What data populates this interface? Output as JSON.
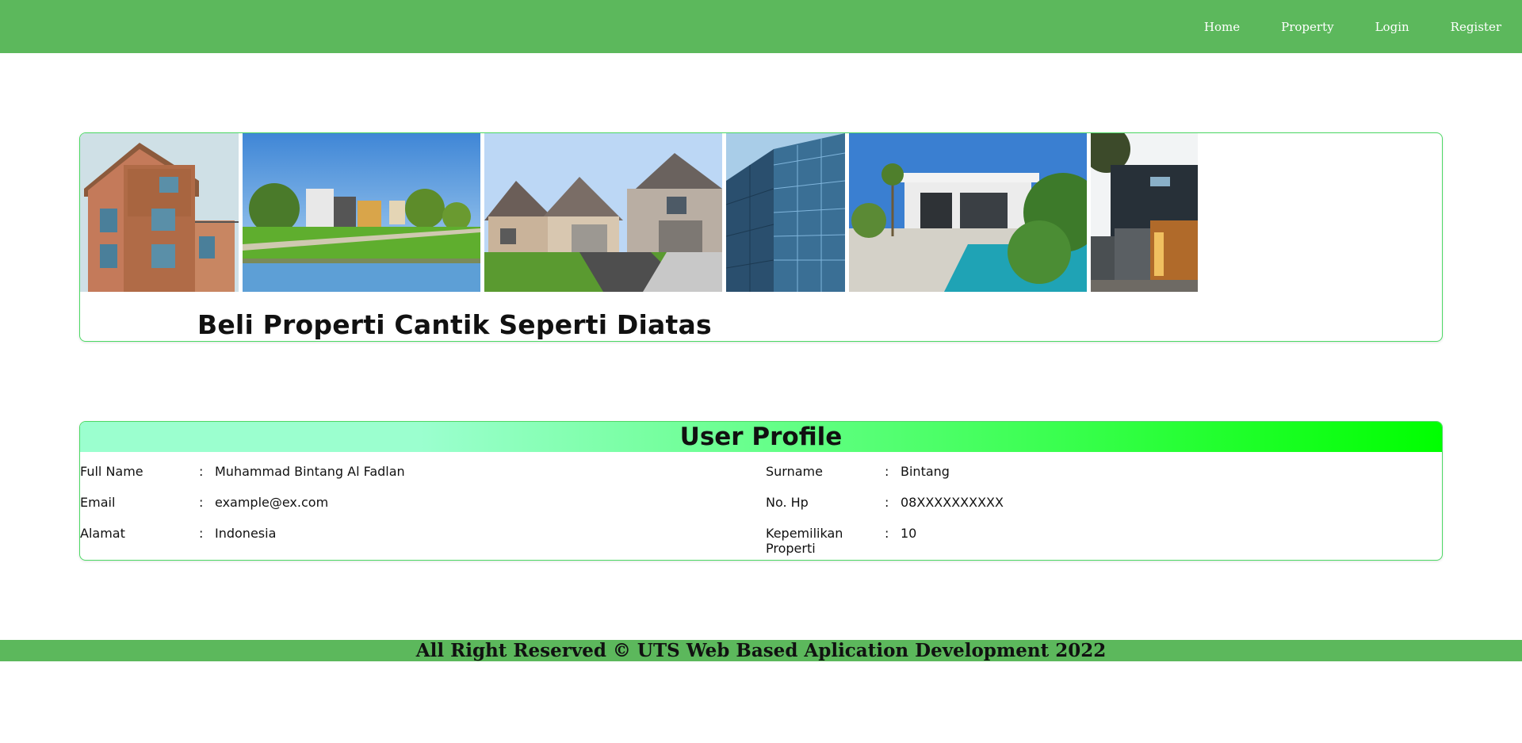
{
  "nav": {
    "links": [
      "Home",
      "Property",
      "Login",
      "Register"
    ]
  },
  "banner": {
    "title": "Beli Properti Cantik Seperti Diatas",
    "photos": [
      "wooden-townhouse-photo",
      "lakeside-houses-photo",
      "suburban-houses-photo",
      "glass-skyscraper-photo",
      "modern-villa-pool-photo",
      "dark-modern-house-photo"
    ]
  },
  "profile": {
    "title": "User Profile",
    "left": [
      {
        "label": "Full Name",
        "value": "Muhammad Bintang Al Fadlan"
      },
      {
        "label": "Email",
        "value": "example@ex.com"
      },
      {
        "label": "Alamat",
        "value": "Indonesia"
      }
    ],
    "right": [
      {
        "label": "Surname",
        "value": "Bintang"
      },
      {
        "label": "No. Hp",
        "value": "08XXXXXXXXXX"
      },
      {
        "label": "Kepemilikan Properti",
        "value": "10"
      }
    ],
    "separator": ":"
  },
  "footer": {
    "text": "All Right Reserved © UTS Web Based Aplication Development 2022"
  },
  "colors": {
    "nav_bg": "#5cb85c",
    "card_border": "#4cd964",
    "gradient_start": "#9bffcf",
    "gradient_end": "#00ff00"
  }
}
